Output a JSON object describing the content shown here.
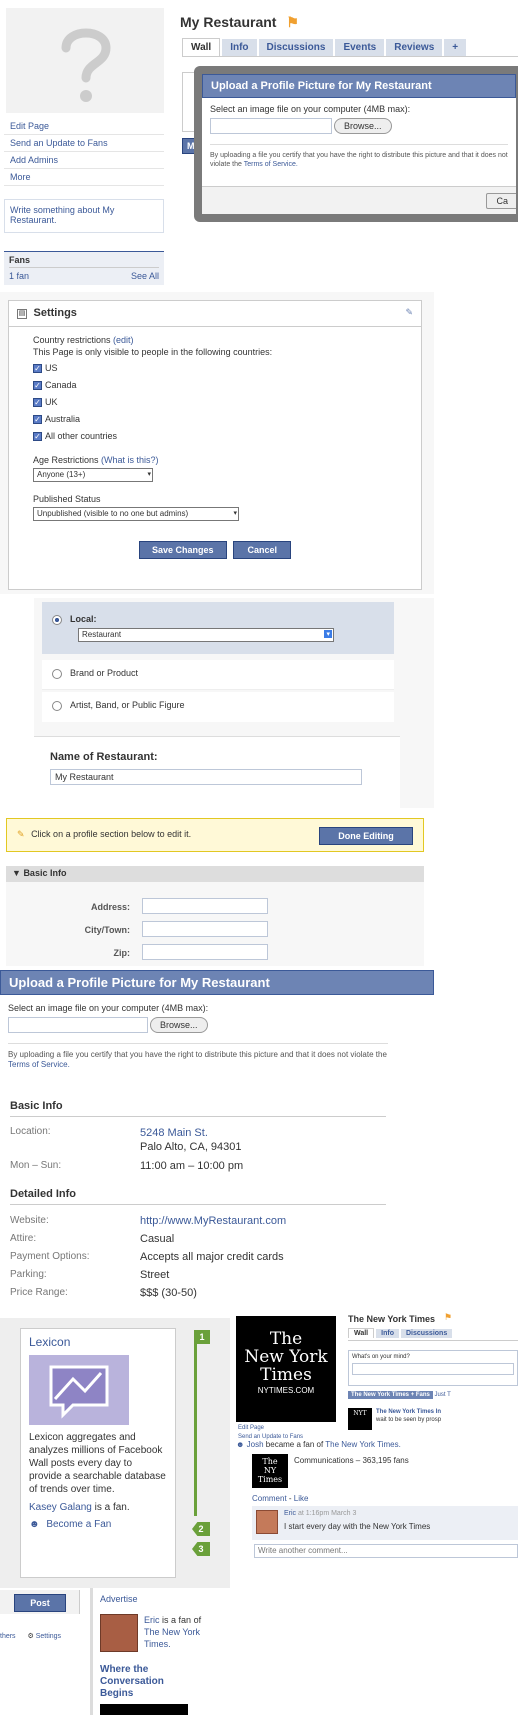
{
  "profile_page": {
    "page_name": "My Restaurant",
    "tabs": [
      "Wall",
      "Info",
      "Discussions",
      "Events",
      "Reviews",
      "+"
    ],
    "side_links": [
      "Edit Page",
      "Send an Update to Fans",
      "Add Admins",
      "More"
    ],
    "write_about": "Write something about My Restaurant.",
    "fans_title": "Fans",
    "fans_count": "1 fan",
    "see_all": "See All",
    "partial_button": "My"
  },
  "upload_dialog_small": {
    "title": "Upload a Profile Picture for My Restaurant",
    "instruction": "Select an image file on your computer (4MB max):",
    "browse": "Browse...",
    "disclaimer": "By uploading a file you certify that you have the right to distribute this picture and that it does not violate the",
    "terms": "Terms of Service.",
    "partial_button": "Ca"
  },
  "settings": {
    "title": "Settings",
    "country_label": "Country restrictions",
    "edit": "(edit)",
    "country_desc": "This Page is only visible to people in the following countries:",
    "countries": [
      "US",
      "Canada",
      "UK",
      "Australia",
      "All other countries"
    ],
    "age_label": "Age Restrictions",
    "what_is": "(What is this?)",
    "age_value": "Anyone (13+)",
    "published_label": "Published Status",
    "published_value": "Unpublished (visible to no one but admins)",
    "save": "Save Changes",
    "cancel": "Cancel"
  },
  "category": {
    "local_label": "Local:",
    "local_value": "Restaurant",
    "brand": "Brand or Product",
    "artist": "Artist, Band, or Public Figure",
    "name_label": "Name of Restaurant:",
    "name_value": "My Restaurant"
  },
  "edit_bar": {
    "text": "Click on a profile section below to edit it.",
    "done": "Done Editing"
  },
  "basic_edit": {
    "title": "Basic Info",
    "fields": [
      "Address:",
      "City/Town:",
      "Zip:"
    ]
  },
  "upload_dialog_large": {
    "title": "Upload a Profile Picture for My Restaurant",
    "instruction": "Select an image file on your computer (4MB max):",
    "browse": "Browse...",
    "disclaimer": "By uploading a file you certify that you have the right to distribute this picture and that it does not violate the",
    "terms": "Terms of Service."
  },
  "info_view": {
    "basic_title": "Basic Info",
    "location_label": "Location:",
    "location_line1": "5248 Main St.",
    "location_line2": "Palo Alto, CA, 94301",
    "hours_label": "Mon – Sun:",
    "hours_value": "11:00 am – 10:00 pm",
    "detailed_title": "Detailed Info",
    "rows": [
      {
        "label": "Website:",
        "value": "http://www.MyRestaurant.com"
      },
      {
        "label": "Attire:",
        "value": "Casual"
      },
      {
        "label": "Payment Options:",
        "value": "Accepts all major credit cards"
      },
      {
        "label": "Parking:",
        "value": "Street"
      },
      {
        "label": "Price Range:",
        "value": "$$$ (30-50)"
      }
    ]
  },
  "lexicon": {
    "title": "Lexicon",
    "description": "Lexicon aggregates and analyzes millions of Facebook Wall posts every day to provide a searchable database of trends over time.",
    "fan_name": "Kasey Galang",
    "fan_suffix": "is a fan.",
    "become_fan": "Become a Fan",
    "markers": [
      "1",
      "2",
      "3"
    ]
  },
  "nyt": {
    "logo_line1": "The",
    "logo_line2": "New York",
    "logo_line3": "Times",
    "logo_sub": "NYTIMES.COM",
    "page_name": "The New York Times",
    "tabs": [
      "Wall",
      "Info",
      "Discussions"
    ],
    "mind_placeholder": "What's on your mind?",
    "filter_active": "The New York Times + Fans",
    "filter_other": "Just T",
    "side_links": [
      "Edit Page",
      "Send an Update to Fans"
    ],
    "post_author": "The New York Times In",
    "post_text": "wait to be seen by prosp",
    "story_user": "Josh",
    "story_text": "became a fan of",
    "story_target": "The New York Times.",
    "comm_label": "Communications –",
    "comm_fans": "363,195 fans",
    "comment": "Comment",
    "like": "Like",
    "commenter": "Eric",
    "comment_time": "at 1:16pm March 3",
    "comment_text": "I start every day with the New York Times",
    "write_comment": "Write another comment..."
  },
  "bottom": {
    "post_button": "Post",
    "others": "thers",
    "settings": "Settings",
    "advertise": "Advertise",
    "ad_user": "Eric",
    "ad_text1": "is a fan",
    "ad_text2": "of",
    "ad_link": "The New York Times.",
    "ad_headline": "Where the Conversation Begins"
  }
}
